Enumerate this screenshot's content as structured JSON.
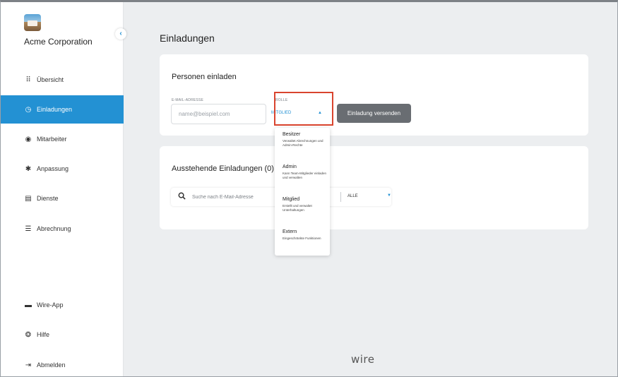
{
  "sidebar": {
    "org_name": "Acme Corporation",
    "collapse_icon": "chevron-left-icon",
    "items": [
      {
        "label": "Übersicht",
        "icon": "grid-icon",
        "glyph": "⠿"
      },
      {
        "label": "Einladungen",
        "icon": "clock-icon",
        "glyph": "◷"
      },
      {
        "label": "Mitarbeiter",
        "icon": "user-circle-icon",
        "glyph": "◉"
      },
      {
        "label": "Anpassung",
        "icon": "gear-icon",
        "glyph": "✱"
      },
      {
        "label": "Dienste",
        "icon": "calendar-icon",
        "glyph": "▤"
      },
      {
        "label": "Abrechnung",
        "icon": "list-icon",
        "glyph": "☰"
      }
    ],
    "bottom_items": [
      {
        "label": "Wire-App",
        "icon": "chat-icon",
        "glyph": "▬"
      },
      {
        "label": "Hilfe",
        "icon": "help-icon",
        "glyph": "❂"
      },
      {
        "label": "Abmelden",
        "icon": "logout-icon",
        "glyph": "⇥"
      }
    ],
    "active_color": "#2391d3"
  },
  "main": {
    "title": "Einladungen",
    "invite": {
      "title": "Personen einladen",
      "email_label": "E-MAIL-ADRESSE",
      "email_placeholder": "name@beispiel.com",
      "role_label": "ROLLE",
      "role_value": "MITGLIED",
      "send_label": "Einladung versenden"
    },
    "pending": {
      "title": "Ausstehende Einladungen (0)",
      "search_placeholder": "Suche nach E-Mail-Adresse",
      "filter_value": "ALLE"
    }
  },
  "role_dropdown": {
    "options": [
      {
        "title": "Besitzer",
        "desc": "Verwaltet Abrechnungen und Admin-Rechte"
      },
      {
        "title": "Admin",
        "desc": "Kann Team-Mitglieder einladen und verwalten"
      },
      {
        "title": "Mitglied",
        "desc": "Erstellt und verwaltet Unterhaltungen"
      },
      {
        "title": "Extern",
        "desc": "Eingeschränkte Funktionen"
      }
    ]
  },
  "footer": {
    "logo_text": "wire"
  },
  "colors": {
    "accent": "#2391d3",
    "highlight": "#d9442e",
    "button": "#696d72"
  }
}
